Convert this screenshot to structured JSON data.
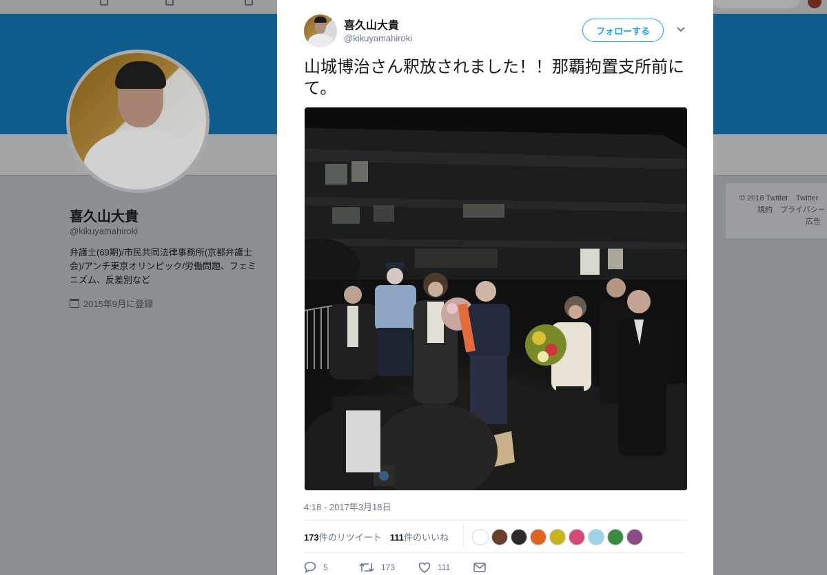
{
  "profile": {
    "name": "喜久山大貴",
    "handle": "@kikuyamahiroki",
    "bio": "弁護士(69期)/市民共同法律事務所(京都弁護士会)/アンチ東京オリンピック/労働問題、フェミニズム、反差別など",
    "joined": "2015年9月に登録"
  },
  "side_footer": {
    "line1": "© 2018 Twitter　Twitter",
    "line2": "規約　プライバシー",
    "line3": "広告"
  },
  "tweet": {
    "author_name": "喜久山大貴",
    "author_handle": "@kikuyamahiroki",
    "follow_label": "フォローする",
    "text": "山城博治さん釈放されました！！那覇拘置支所前にて。",
    "timestamp": "4:18 - 2017年3月18日",
    "retweet_count": "173",
    "retweet_label": "件のリツイート",
    "like_count": "111",
    "like_label": "件のいいね",
    "reply_count": "5",
    "action_retweet_count": "173",
    "action_like_count": "111"
  },
  "likers_colors": [
    "#ffffff",
    "#6b3d2a",
    "#2f2a28",
    "#e0631f",
    "#c9b21c",
    "#d64a7a",
    "#9fd3e6",
    "#3b8a3e",
    "#8f4a8a"
  ],
  "colors": {
    "accent": "#1da1f2",
    "banner": "#105c8c",
    "overlay": "#8c8f92"
  },
  "icons": {
    "reply": "speech-bubble-icon",
    "retweet": "retweet-arrows-icon",
    "like": "heart-icon",
    "dm": "envelope-icon",
    "more": "chevron-down-icon",
    "joined": "calendar-icon"
  }
}
